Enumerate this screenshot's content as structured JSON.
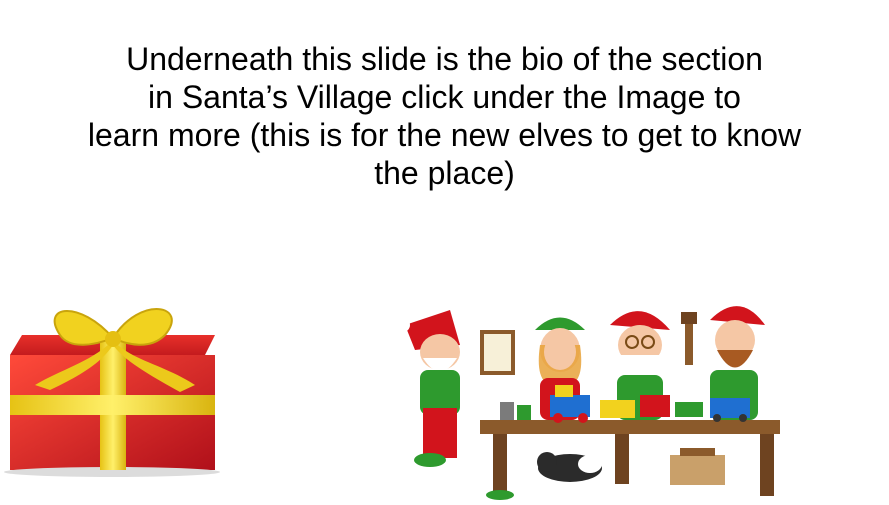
{
  "slide": {
    "text_lines": [
      "Underneath this slide is the bio of the section",
      "in Santa’s Village click under the Image to",
      "learn more (this is for the new elves to get to know",
      "the place)"
    ],
    "left_image": {
      "icon": "gift-box-icon",
      "box_color": "#d61f1f",
      "ribbon_color": "#f2d21e"
    },
    "right_image": {
      "icon": "elves-workshop-illustration",
      "hat_color": "#d2141c",
      "table_color": "#8b5a2b"
    }
  }
}
